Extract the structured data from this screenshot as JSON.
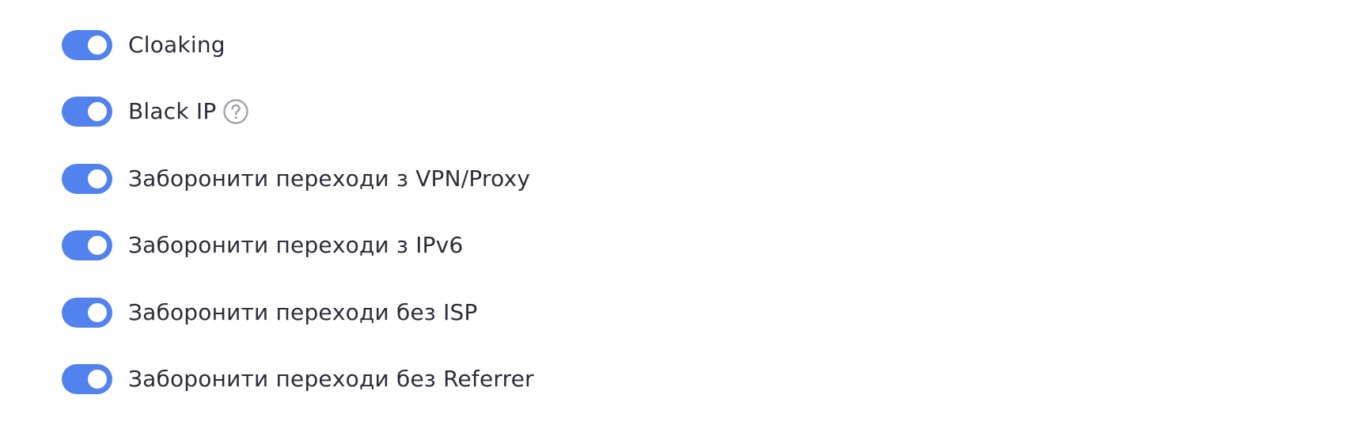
{
  "settings": {
    "toggles": [
      {
        "label": "Cloaking",
        "enabled": true
      },
      {
        "label": "Black IP",
        "enabled": true,
        "help_icon": "help-circle-icon"
      },
      {
        "label": "Заборонити переходи з VPN/Proxy",
        "enabled": true
      },
      {
        "label": "Заборонити переходи з IPv6",
        "enabled": true
      },
      {
        "label": "Заборонити переходи без ISP",
        "enabled": true
      },
      {
        "label": "Заборонити переходи без Referrer",
        "enabled": true
      }
    ]
  },
  "colors": {
    "switch_on": "#5182ee",
    "switch_knob": "#ffffff",
    "label_text": "#2c2d3a",
    "help_icon": "#a2a2ad"
  }
}
